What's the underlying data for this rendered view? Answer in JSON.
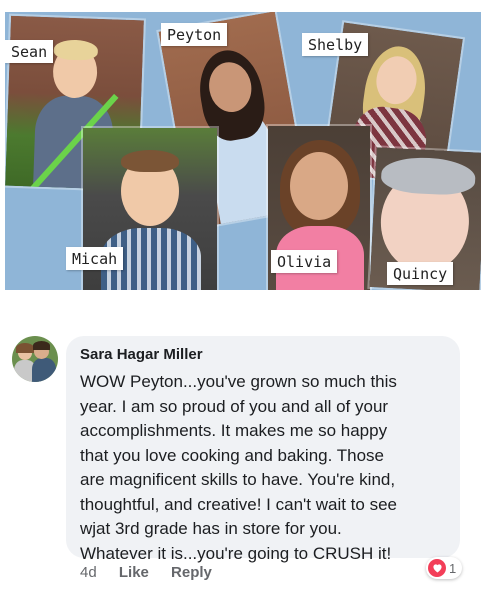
{
  "collage": {
    "names": {
      "sean": "Sean",
      "peyton": "Peyton",
      "shelby": "Shelby",
      "micah": "Micah",
      "olivia": "Olivia",
      "quincy": "Quincy"
    }
  },
  "comment": {
    "author": "Sara Hagar Miller",
    "text": "WOW Peyton...you've grown so much this\nyear.  I am so proud of you and all of your\naccomplishments.  It makes me so happy\nthat you love cooking and baking.  Those\nare magnificent skills to have.  You're kind,\nthoughtful, and creative! I can't wait to see\nwjat 3rd grade has in store for you.\nWhatever it is...you're going to CRUSH it!",
    "time": "4d",
    "like_label": "Like",
    "reply_label": "Reply",
    "reaction": {
      "icon": "heart-icon",
      "count": "1",
      "color": "#f33e58"
    }
  }
}
